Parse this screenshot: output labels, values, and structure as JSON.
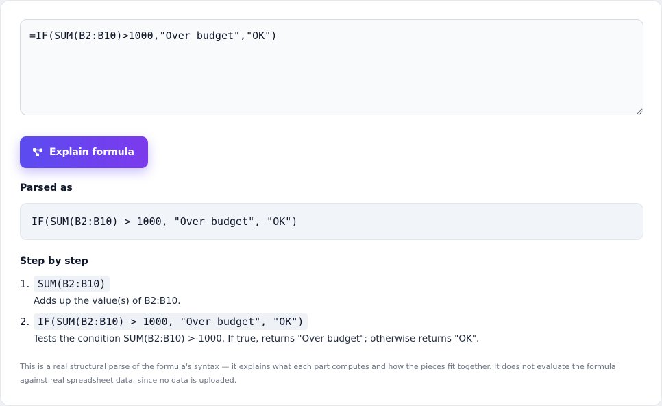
{
  "input": {
    "formula": "=IF(SUM(B2:B10)>1000,\"Over budget\",\"OK\")"
  },
  "explain_button": {
    "label": "Explain formula",
    "icon": "diagram-nodes-icon"
  },
  "parsed": {
    "title": "Parsed as",
    "expression": "IF(SUM(B2:B10) > 1000, \"Over budget\", \"OK\")"
  },
  "steps": {
    "title": "Step by step",
    "items": [
      {
        "number": "1.",
        "code": "SUM(B2:B10)",
        "description": "Adds up the value(s) of B2:B10."
      },
      {
        "number": "2.",
        "code": "IF(SUM(B2:B10) > 1000, \"Over budget\", \"OK\")",
        "description": "Tests the condition SUM(B2:B10) > 1000. If true, returns \"Over budget\"; otherwise returns \"OK\"."
      }
    ]
  },
  "disclaimer": "This is a real structural parse of the formula's syntax — it explains what each part computes and how the pieces fit together. It does not evaluate the formula against real spreadsheet data, since no data is uploaded.",
  "colors": {
    "accent_start": "#5b4cf0",
    "accent_end": "#7c3aed"
  }
}
